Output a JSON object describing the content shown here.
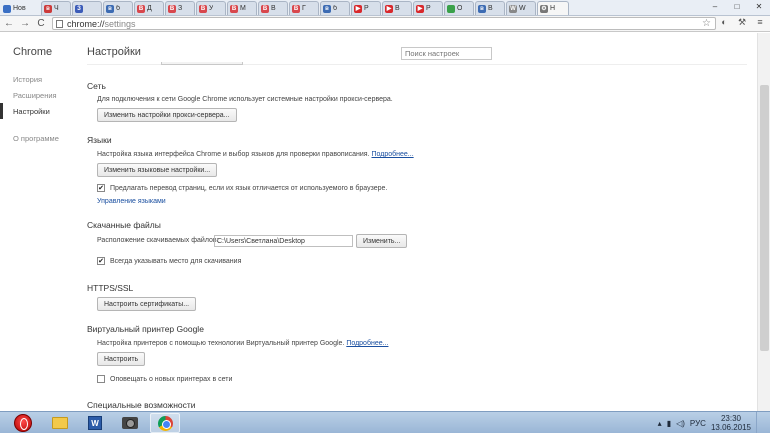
{
  "tabs": [
    {
      "title": "Нов",
      "color": "#3a6fc4",
      "glyph": "",
      "kind": "first"
    },
    {
      "title": "Ч",
      "color": "#cc3a3a",
      "glyph": "в"
    },
    {
      "title": "",
      "color": "#3b5bb8",
      "glyph": "З"
    },
    {
      "title": "б",
      "color": "#3c6bb3",
      "glyph": "в"
    },
    {
      "title": "Д",
      "color": "#d8474d",
      "glyph": "В"
    },
    {
      "title": "З",
      "color": "#d8474d",
      "glyph": "В"
    },
    {
      "title": "У",
      "color": "#d8474d",
      "glyph": "В"
    },
    {
      "title": "М",
      "color": "#d8474d",
      "glyph": "В"
    },
    {
      "title": "В",
      "color": "#d8474d",
      "glyph": "В"
    },
    {
      "title": "Г",
      "color": "#d8474d",
      "glyph": "В"
    },
    {
      "title": "б",
      "color": "#3c6bb3",
      "glyph": "в"
    },
    {
      "title": "Р",
      "color": "#d8282c",
      "glyph": "▶"
    },
    {
      "title": "В",
      "color": "#d8282c",
      "glyph": "▶"
    },
    {
      "title": "Р",
      "color": "#d8282c",
      "glyph": "▶"
    },
    {
      "title": "О",
      "color": "#3aa14a",
      "glyph": ""
    },
    {
      "title": "В",
      "color": "#3c6bb3",
      "glyph": "в"
    },
    {
      "title": "W",
      "color": "#888888",
      "glyph": "W"
    },
    {
      "title": "Н",
      "color": "#777777",
      "glyph": "⚙",
      "kind": "active"
    }
  ],
  "window_controls": {
    "minimize": "–",
    "maximize": "□",
    "close": "✕"
  },
  "toolbar": {
    "back": "←",
    "forward": "→",
    "reload": "C",
    "url_scheme": "chrome://",
    "url_path": "settings",
    "star": "☆"
  },
  "sidebar": {
    "brand": "Chrome",
    "items": [
      {
        "label": "История"
      },
      {
        "label": "Расширения"
      },
      {
        "label": "Настройки"
      }
    ],
    "about": "О программе"
  },
  "main": {
    "title": "Настройки",
    "search_placeholder": "Поиск настроек"
  },
  "network": {
    "heading": "Сеть",
    "description": "Для подключения к сети Google Chrome использует системные настройки прокси-сервера.",
    "button": "Изменить настройки прокси-сервера..."
  },
  "languages": {
    "heading": "Языки",
    "description": "Настройка языка интерфейса Chrome и выбор языков для проверки правописания.",
    "more_link": "Подробнее...",
    "button": "Изменить языковые настройки...",
    "translate_label": "Предлагать перевод страниц, если их язык отличается от используемого в браузере.",
    "translate_checked": true,
    "manage_link": "Управление языками"
  },
  "downloads": {
    "heading": "Скачанные файлы",
    "location_label": "Расположение скачиваемых файлов:",
    "location_value": "C:\\Users\\Светлана\\Desktop",
    "change_button": "Изменить...",
    "ask_label": "Всегда указывать место для скачивания",
    "ask_checked": true
  },
  "https": {
    "heading": "HTTPS/SSL",
    "button": "Настроить сертификаты..."
  },
  "cloud_print": {
    "heading": "Виртуальный принтер Google",
    "description": "Настройка принтеров с помощью технологии Виртуальный принтер Google.",
    "more_link": "Подробнее...",
    "button": "Настроить",
    "notify_label": "Оповещать о новых принтерах в сети",
    "notify_checked": false
  },
  "accessibility": {
    "heading": "Специальные возможности"
  },
  "taskbar": {
    "tray_lang": "РУС",
    "time": "23:30",
    "date": "13.06.2015"
  }
}
